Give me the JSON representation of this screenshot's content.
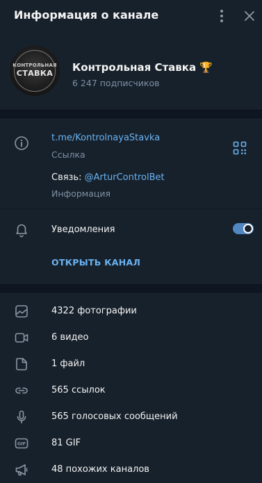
{
  "header": {
    "title": "Информация о канале"
  },
  "profile": {
    "avatar_line1": "КОНТРОЛЬНАЯ",
    "avatar_line2": "СТАВКА",
    "name": "Контрольная Ставка 🏆",
    "subscribers": "6 247 подписчиков"
  },
  "info": {
    "link": "t.me/KontrolnayaStavka",
    "link_label": "Ссылка",
    "contact_prefix": "Связь: ",
    "contact_mention": "@ArturControlBet",
    "contact_label": "Информация",
    "notifications_label": "Уведомления",
    "notifications_on": true,
    "open_channel": "ОТКРЫТЬ КАНАЛ"
  },
  "media": [
    {
      "icon": "photo-icon",
      "label": "4322 фотографии"
    },
    {
      "icon": "video-icon",
      "label": "6 видео"
    },
    {
      "icon": "file-icon",
      "label": "1 файл"
    },
    {
      "icon": "link-icon",
      "label": "565 ссылок"
    },
    {
      "icon": "microphone-icon",
      "label": "565 голосовых сообщений"
    },
    {
      "icon": "gif-icon",
      "label": "81 GIF"
    },
    {
      "icon": "megaphone-icon",
      "label": "48 похожих каналов"
    }
  ],
  "colors": {
    "background": "#17212b",
    "separator": "#0e1621",
    "accent": "#6ab3f3",
    "secondary_text": "#7f91a4",
    "toggle": "#5288c1"
  }
}
